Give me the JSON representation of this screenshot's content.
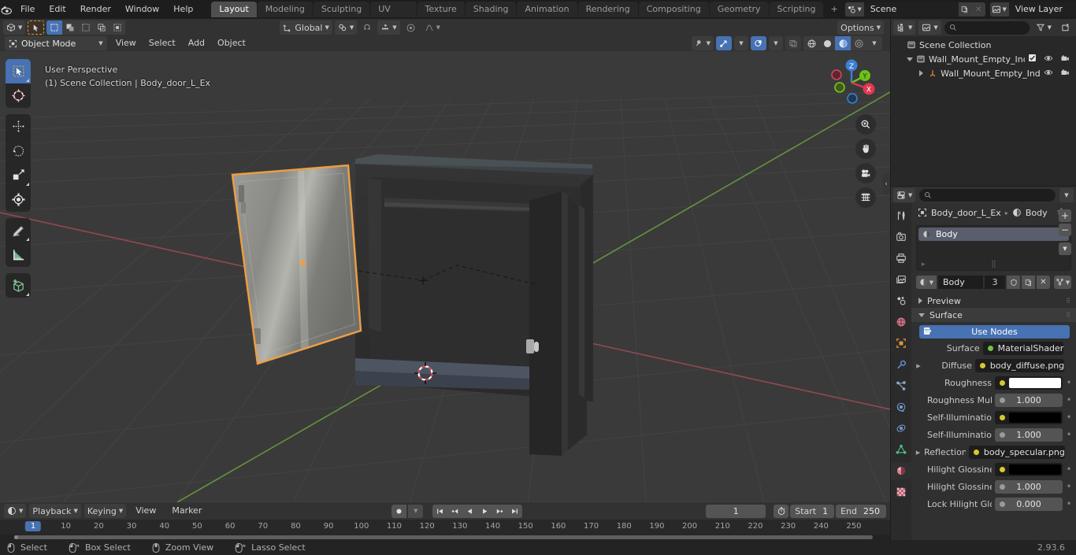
{
  "app": {
    "version": "2.93.6"
  },
  "topbar": {
    "logo_icon": "blender-logo-icon",
    "menus": [
      "File",
      "Edit",
      "Render",
      "Window",
      "Help"
    ],
    "workspace_tabs": [
      "Layout",
      "Modeling",
      "Sculpting",
      "UV Editing",
      "Texture Paint",
      "Shading",
      "Animation",
      "Rendering",
      "Compositing",
      "Geometry Nodes",
      "Scripting"
    ],
    "active_workspace": "Layout",
    "add_workspace_label": "+",
    "scene": {
      "icon": "scene-icon",
      "name": "Scene",
      "new_icon": "duplicate-icon",
      "unlink_icon": "x-icon"
    },
    "view_layer": {
      "icon": "view-layer-icon",
      "name": "View Layer",
      "new_icon": "duplicate-icon",
      "unlink_icon": "x-icon"
    }
  },
  "viewport_header": {
    "editor_type_icon": "editor-type-3dview-icon",
    "mode": "Object Mode",
    "menus": [
      "View",
      "Select",
      "Add",
      "Object"
    ],
    "transform_orientation": "Global",
    "snap_icon": "magnet-icon",
    "proportional_icon": "proportional-edit-icon",
    "options_label": "Options",
    "shading_modes": [
      "wireframe",
      "solid",
      "material-preview",
      "rendered"
    ],
    "active_shading": "material-preview"
  },
  "viewport": {
    "perspective_label": "User Perspective",
    "scene_info": "(1) Scene Collection | Body_door_L_Ex",
    "toolbar_tools": [
      {
        "name": "tweak-tool",
        "icon": "cursor-arrow-icon",
        "active": true
      },
      {
        "name": "cursor-tool",
        "icon": "3d-cursor-icon",
        "active": false
      },
      {
        "name": "move-tool",
        "icon": "move-arrows-icon",
        "active": false
      },
      {
        "name": "rotate-tool",
        "icon": "rotate-icon",
        "active": false
      },
      {
        "name": "scale-tool",
        "icon": "scale-icon",
        "active": false
      },
      {
        "name": "transform-tool",
        "icon": "transform-icon",
        "active": false
      },
      {
        "name": "annotate-tool",
        "icon": "pencil-icon",
        "active": false
      },
      {
        "name": "measure-tool",
        "icon": "ruler-icon",
        "active": false
      },
      {
        "name": "add-cube-tool",
        "icon": "add-cube-icon",
        "active": false
      }
    ],
    "gizmo_axes": [
      {
        "label": "Z",
        "color": "#3b7fd4"
      },
      {
        "label": "Y",
        "color": "#6cc21a"
      },
      {
        "label": "X",
        "color": "#e0384f"
      }
    ],
    "nav_buttons": [
      "zoom-icon",
      "hand-pan-icon",
      "camera-icon",
      "grid-ortho-icon"
    ],
    "grid_color": "#4a4a4a",
    "bg_color": "#3a3a3a",
    "x_axis_color": "#9b4a52",
    "y_axis_color": "#6a9b3f",
    "selection_outline_color": "#ed9e44"
  },
  "outliner": {
    "display_mode_icon": "outliner-icon",
    "filter_id_icon": "image-icon",
    "search_placeholder": "",
    "search_icon": "search-icon",
    "filter_icon": "funnel-icon",
    "new_collection_icon": "new-collection-icon",
    "rows": [
      {
        "label": "Scene Collection",
        "icon": "collection-icon",
        "indent": 0,
        "expander": "none",
        "checkbox": false,
        "eye": false,
        "camera": false
      },
      {
        "label": "Wall_Mount_Empty_Industrial_",
        "icon": "collection-icon",
        "indent": 1,
        "expander": "down",
        "checkbox": true,
        "eye": true,
        "camera": true
      },
      {
        "label": "Wall_Mount_Empty_Indus",
        "icon": "empty-axis-icon",
        "indent": 2,
        "expander": "right",
        "checkbox": false,
        "eye": true,
        "camera": true
      }
    ]
  },
  "properties": {
    "editor_icon": "properties-editor-icon",
    "search_placeholder": "",
    "search_icon": "search-icon",
    "dropdown_icon": "chevron-down-icon",
    "tabs": [
      {
        "name": "tool-tab",
        "icon": "tool-icon",
        "active": false
      },
      {
        "name": "render-tab",
        "icon": "camera-back-icon",
        "active": false
      },
      {
        "name": "output-tab",
        "icon": "printer-icon",
        "active": false
      },
      {
        "name": "view-layer-tab",
        "icon": "images-icon",
        "active": false
      },
      {
        "name": "scene-tab",
        "icon": "scene-cone-icon",
        "active": false
      },
      {
        "name": "world-tab",
        "icon": "world-globe-icon",
        "active": false
      },
      {
        "name": "object-tab",
        "icon": "object-square-icon",
        "active": false
      },
      {
        "name": "modifier-tab",
        "icon": "wrench-icon",
        "active": false
      },
      {
        "name": "particles-tab",
        "icon": "particles-icon",
        "active": false
      },
      {
        "name": "physics-tab",
        "icon": "physics-orbit-icon",
        "active": false
      },
      {
        "name": "constraints-tab",
        "icon": "constraint-icon",
        "active": false
      },
      {
        "name": "data-tab",
        "icon": "mesh-data-icon",
        "active": false
      },
      {
        "name": "material-tab",
        "icon": "material-sphere-icon",
        "active": true
      },
      {
        "name": "texture-tab",
        "icon": "checker-texture-icon",
        "active": false
      }
    ],
    "breadcrumb": {
      "object_icon": "object-square-icon",
      "object": "Body_door_L_Ex",
      "separator_icon": "chevron-right-icon",
      "material_icon": "material-sphere-icon",
      "material": "Body",
      "pin_icon": "pin-icon"
    },
    "slot_list": [
      {
        "name": "Body",
        "icon": "material-sphere-icon",
        "selected": true
      }
    ],
    "slot_side_buttons": [
      "plus-icon",
      "minus-icon",
      "chevron-down-icon"
    ],
    "material_block": {
      "browse_icon": "material-sphere-icon",
      "name": "Body",
      "users": "3",
      "shield_icon": "fake-user-shield-icon",
      "copy_icon": "new-material-icon",
      "unlink_icon": "x-icon",
      "node_filter_icon": "nodetree-icon"
    },
    "panels": [
      {
        "title": "Preview",
        "open": false
      },
      {
        "title": "Surface",
        "open": true
      }
    ],
    "use_nodes_label": "Use Nodes",
    "use_nodes_icon": "nodes-icon",
    "fields": [
      {
        "label": "Surface",
        "type": "link",
        "value": "MaterialShader",
        "dot": "#6ec246",
        "expander": false,
        "decor": false
      },
      {
        "label": "Diffuse",
        "type": "link",
        "value": "body_diffuse.png",
        "dot": "#d8c92c",
        "expander": true,
        "decor": false
      },
      {
        "label": "Roughness",
        "type": "color",
        "value": "",
        "dot": "#d8c92c",
        "expander": false,
        "decor": true,
        "swatch": "#ffffff"
      },
      {
        "label": "Roughness Mult...",
        "type": "slider",
        "value": "1.000",
        "dot": "#9a9a9a",
        "expander": false,
        "decor": true
      },
      {
        "label": "Self-Illumination",
        "type": "color",
        "value": "",
        "dot": "#d8c92c",
        "expander": false,
        "decor": true,
        "swatch": "#000000"
      },
      {
        "label": "Self-Illumination...",
        "type": "slider",
        "value": "1.000",
        "dot": "#9a9a9a",
        "expander": false,
        "decor": true
      },
      {
        "label": "Reflection",
        "type": "link",
        "value": "body_specular.png",
        "dot": "#d8c92c",
        "expander": true,
        "decor": false
      },
      {
        "label": "Hilight Glossiness",
        "type": "color",
        "value": "",
        "dot": "#d8c92c",
        "expander": false,
        "decor": true,
        "swatch": "#000000"
      },
      {
        "label": "Hilight Glossines...",
        "type": "slider",
        "value": "1.000",
        "dot": "#9a9a9a",
        "expander": false,
        "decor": true
      },
      {
        "label": "Lock Hilight Glo...",
        "type": "slider",
        "value": "0.000",
        "dot": "#9a9a9a",
        "expander": false,
        "decor": true
      }
    ]
  },
  "timeline": {
    "editor_icon": "timeline-editor-icon",
    "menus_dropdown": [
      "Playback",
      "Keying"
    ],
    "menus": [
      "View",
      "Marker"
    ],
    "record_icon": "record-icon",
    "transport": [
      "jump-start-icon",
      "prev-keyframe-icon",
      "play-reverse-icon",
      "play-icon",
      "next-keyframe-icon",
      "jump-end-icon"
    ],
    "current_frame": "1",
    "auto_key_icon": "stopwatch-icon",
    "start_label": "Start",
    "start_value": "1",
    "end_label": "End",
    "end_value": "250",
    "playhead_frame": "1",
    "ruler_ticks": [
      "10",
      "20",
      "30",
      "40",
      "50",
      "60",
      "70",
      "80",
      "90",
      "100",
      "110",
      "120",
      "130",
      "140",
      "150",
      "160",
      "170",
      "180",
      "190",
      "200",
      "210",
      "220",
      "230",
      "240",
      "250"
    ]
  },
  "status_bar": {
    "items": [
      {
        "icon": "mouse-left-icon",
        "label": "Select"
      },
      {
        "icon": "mouse-left-drag-icon",
        "label": "Box Select"
      },
      {
        "icon": "mouse-middle-icon",
        "label": "Zoom View"
      },
      {
        "icon": "mouse-left-drag-icon",
        "label": "Lasso Select"
      }
    ],
    "version": "2.93.6"
  }
}
